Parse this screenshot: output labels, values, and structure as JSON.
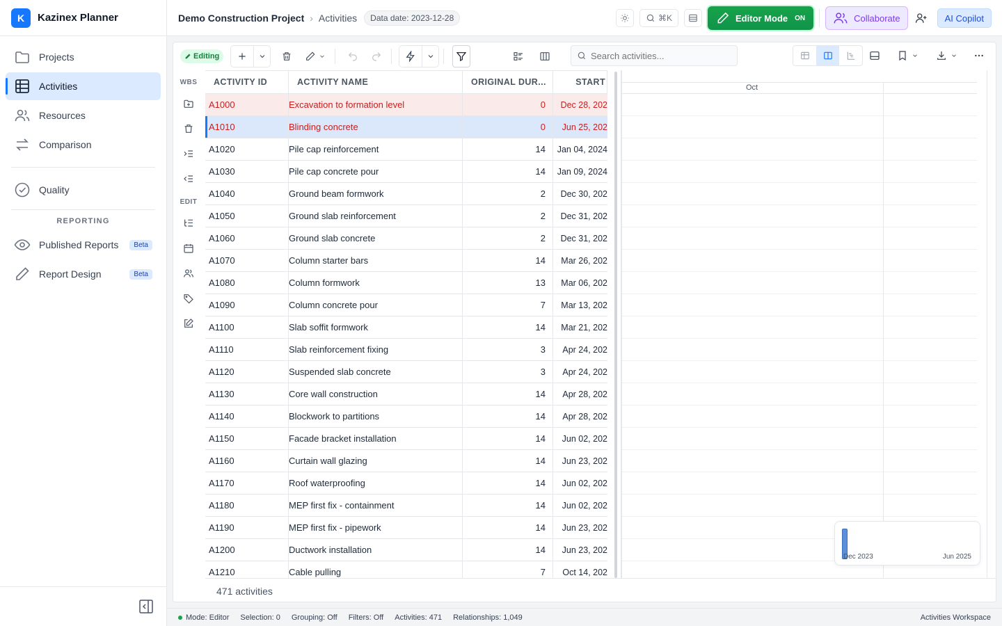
{
  "app": {
    "logo_letter": "K",
    "name": "Kazinex Planner"
  },
  "sidebar": {
    "items": [
      {
        "label": "Projects",
        "icon": "folder-icon"
      },
      {
        "label": "Activities",
        "icon": "grid-icon",
        "active": true
      },
      {
        "label": "Resources",
        "icon": "people-icon"
      },
      {
        "label": "Comparison",
        "icon": "swap-icon"
      },
      {
        "label": "Quality",
        "icon": "check-circle-icon"
      }
    ],
    "reporting_title": "REPORTING",
    "reporting_items": [
      {
        "label": "Published Reports",
        "badge": "Beta",
        "icon": "eye-icon"
      },
      {
        "label": "Report Design",
        "badge": "Beta",
        "icon": "pencil-icon"
      }
    ]
  },
  "header": {
    "project": "Demo Construction Project",
    "separator": "›",
    "page": "Activities",
    "data_date": "Data date: 2023-12-28",
    "search_shortcut": "⌘K",
    "editor_mode_label": "Editor Mode",
    "editor_mode_state": "ON",
    "collaborate_label": "Collaborate",
    "copilot_label": "AI Copilot"
  },
  "toolbar": {
    "editing_label": "Editing",
    "search_placeholder": "Search activities..."
  },
  "rail": {
    "wbs_label": "WBS",
    "edit_label": "EDIT"
  },
  "grid": {
    "columns": [
      "ACTIVITY ID",
      "ACTIVITY NAME",
      "ORIGINAL DUR...",
      "START"
    ],
    "rows": [
      {
        "id": "A1000",
        "name": "Excavation to formation level",
        "dur": "0",
        "start": "Dec 28, 202",
        "state": "crit"
      },
      {
        "id": "A1010",
        "name": "Blinding concrete",
        "dur": "0",
        "start": "Jun 25, 202",
        "state": "sel"
      },
      {
        "id": "A1020",
        "name": "Pile cap reinforcement",
        "dur": "14",
        "start": "Jan 04, 2024",
        "state": ""
      },
      {
        "id": "A1030",
        "name": "Pile cap concrete pour",
        "dur": "14",
        "start": "Jan 09, 2024",
        "state": ""
      },
      {
        "id": "A1040",
        "name": "Ground beam formwork",
        "dur": "2",
        "start": "Dec 30, 202",
        "state": ""
      },
      {
        "id": "A1050",
        "name": "Ground slab reinforcement",
        "dur": "2",
        "start": "Dec 31, 202",
        "state": ""
      },
      {
        "id": "A1060",
        "name": "Ground slab concrete",
        "dur": "2",
        "start": "Dec 31, 202",
        "state": ""
      },
      {
        "id": "A1070",
        "name": "Column starter bars",
        "dur": "14",
        "start": "Mar 26, 202",
        "state": ""
      },
      {
        "id": "A1080",
        "name": "Column formwork",
        "dur": "13",
        "start": "Mar 06, 202",
        "state": ""
      },
      {
        "id": "A1090",
        "name": "Column concrete pour",
        "dur": "7",
        "start": "Mar 13, 202",
        "state": ""
      },
      {
        "id": "A1100",
        "name": "Slab soffit formwork",
        "dur": "14",
        "start": "Mar 21, 202",
        "state": ""
      },
      {
        "id": "A1110",
        "name": "Slab reinforcement fixing",
        "dur": "3",
        "start": "Apr 24, 202",
        "state": ""
      },
      {
        "id": "A1120",
        "name": "Suspended slab concrete",
        "dur": "3",
        "start": "Apr 24, 202",
        "state": ""
      },
      {
        "id": "A1130",
        "name": "Core wall construction",
        "dur": "14",
        "start": "Apr 28, 202",
        "state": ""
      },
      {
        "id": "A1140",
        "name": "Blockwork to partitions",
        "dur": "14",
        "start": "Apr 28, 202",
        "state": ""
      },
      {
        "id": "A1150",
        "name": "Facade bracket installation",
        "dur": "14",
        "start": "Jun 02, 202",
        "state": ""
      },
      {
        "id": "A1160",
        "name": "Curtain wall glazing",
        "dur": "14",
        "start": "Jun 23, 202",
        "state": ""
      },
      {
        "id": "A1170",
        "name": "Roof waterproofing",
        "dur": "14",
        "start": "Jun 02, 202",
        "state": ""
      },
      {
        "id": "A1180",
        "name": "MEP first fix - containment",
        "dur": "14",
        "start": "Jun 02, 202",
        "state": ""
      },
      {
        "id": "A1190",
        "name": "MEP first fix - pipework",
        "dur": "14",
        "start": "Jun 23, 202",
        "state": ""
      },
      {
        "id": "A1200",
        "name": "Ductwork installation",
        "dur": "14",
        "start": "Jun 23, 202",
        "state": ""
      },
      {
        "id": "A1210",
        "name": "Cable pulling",
        "dur": "7",
        "start": "Oct 14, 202",
        "state": ""
      }
    ],
    "count_label": "471 activities"
  },
  "gantt": {
    "month_label": "Oct",
    "minimap_start": "Dec 2023",
    "minimap_end": "Jun 2025"
  },
  "status": {
    "mode": "Mode: Editor",
    "selection": "Selection: 0",
    "grouping": "Grouping: Off",
    "filters": "Filters: Off",
    "activities": "Activities: 471",
    "relationships": "Relationships: 1,049",
    "workspace": "Activities Workspace"
  },
  "colors": {
    "accent": "#1677ff",
    "editor_green": "#16a34a",
    "critical_text": "#c81e1e",
    "critical_row_bg": "#fbeaea",
    "selected_row_bg": "#dbe8fb"
  }
}
